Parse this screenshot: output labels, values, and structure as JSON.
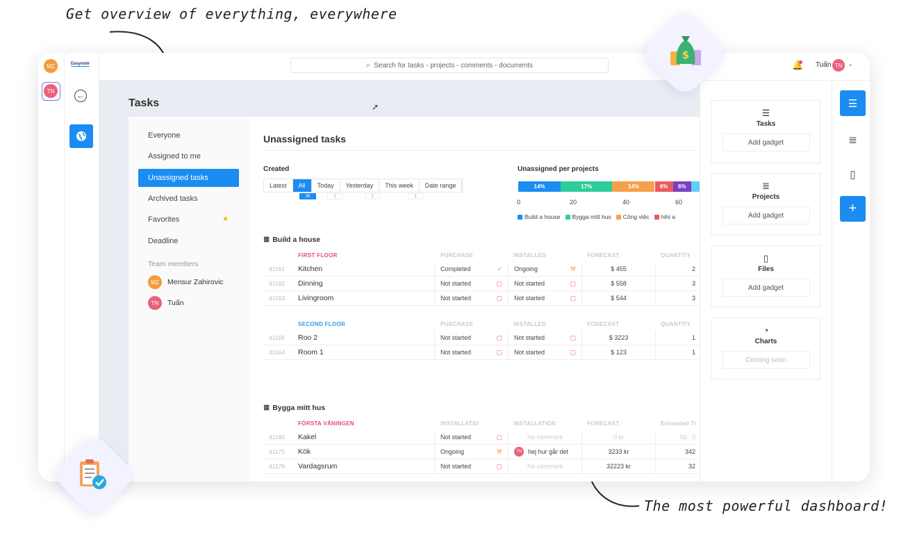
{
  "captions": {
    "top": "Get overview of everything, everywhere",
    "bottom": "The most powerful dashboard!"
  },
  "app": {
    "logo": "Easynote",
    "search_placeholder": "Search for tasks - projects - comments - documents",
    "user_name": "Tuấn",
    "user_initials": "TN",
    "rail_avatars": [
      {
        "initials": "MZ",
        "color": "#f39c3c"
      },
      {
        "initials": "TN",
        "color": "#e9627a"
      }
    ]
  },
  "page": {
    "title": "Tasks"
  },
  "leftnav": {
    "items": [
      "Everyone",
      "Assigned to me",
      "Unassigned tasks",
      "Archived tasks",
      "Favorites",
      "Deadline"
    ],
    "team_label": "Team members",
    "members": [
      {
        "initials": "MZ",
        "name": "Mensur Zahirovic",
        "color": "#f39c3c"
      },
      {
        "initials": "TN",
        "name": "Tuấn",
        "color": "#e9627a"
      }
    ]
  },
  "main": {
    "title": "Unassigned tasks",
    "created_label": "Created",
    "filters": [
      "Latest",
      "All",
      "Today",
      "Yesterday",
      "This week",
      "Date range"
    ],
    "all_count": "36",
    "sub_counts": [
      "1",
      "1",
      "1"
    ],
    "chart_label": "Unassigned per projects"
  },
  "chart_data": {
    "type": "bar",
    "orientation": "stacked-horizontal",
    "series": [
      {
        "name": "Build a house",
        "value": 14,
        "color": "#1b8cf1",
        "label": "14%"
      },
      {
        "name": "Bygga mitt hus",
        "value": 17,
        "color": "#2ecc9a",
        "label": "17%"
      },
      {
        "name": "Công việc",
        "value": 14,
        "color": "#f7a04b",
        "label": "14%"
      },
      {
        "name": "hihi a",
        "value": 6,
        "color": "#ea5a5a",
        "label": "6%"
      },
      {
        "name": "",
        "value": 6,
        "color": "#7b3fc2",
        "label": "6%"
      },
      {
        "name": "",
        "value": 18,
        "color": "#5fd0f5",
        "label": ""
      }
    ],
    "ticks": [
      "0",
      "20",
      "40",
      "60"
    ],
    "xlim": [
      0,
      60
    ]
  },
  "groups": [
    {
      "name": "Build a house",
      "sections": [
        {
          "name": "FIRST FLOOR",
          "color": "pink",
          "columns": [
            "PURCHASE",
            "INSTALLED",
            "FORECAST",
            "QUANTITY"
          ],
          "rows": [
            {
              "id": "41161",
              "name": "Kitchen",
              "c1": "Completed",
              "i1": "check",
              "c2": "Ongoing",
              "i2": "hammer",
              "forecast": "$ 455",
              "qty": "2"
            },
            {
              "id": "41162",
              "name": "Dinning",
              "c1": "Not started",
              "i1": "box",
              "c2": "Not started",
              "i2": "box",
              "forecast": "$ 558",
              "qty": "3"
            },
            {
              "id": "41163",
              "name": "Livingroom",
              "c1": "Not started",
              "i1": "box",
              "c2": "Not started",
              "i2": "box",
              "forecast": "$ 544",
              "qty": "3"
            }
          ]
        },
        {
          "name": "SECOND FLOOR",
          "color": "blue",
          "columns": [
            "PURCHASE",
            "INSTALLED",
            "FORECAST",
            "QUANTITY"
          ],
          "rows": [
            {
              "id": "41165",
              "name": "Roo 2",
              "c1": "Not started",
              "i1": "box",
              "c2": "Not started",
              "i2": "box",
              "forecast": "$ 3223",
              "qty": "1"
            },
            {
              "id": "41164",
              "name": "Room 1",
              "c1": "Not started",
              "i1": "box",
              "c2": "Not started",
              "i2": "box",
              "forecast": "$ 123",
              "qty": "1"
            }
          ]
        }
      ]
    },
    {
      "name": "Bygga mitt hus",
      "sections": [
        {
          "name": "FÖRSTA VÅNINGEN",
          "color": "pink",
          "columns": [
            "INSTALLATIO",
            "INSTALLATION",
            "FORECAST",
            "Estimated Ti"
          ],
          "rows": [
            {
              "id": "41180",
              "name": "Kakel",
              "c1": "Not started",
              "i1": "box",
              "c2": "No comment",
              "i2": "",
              "forecast": "0 kr",
              "qty": "0d : 0"
            },
            {
              "id": "41175",
              "name": "Kök",
              "c1": "Ongoing",
              "i1": "hammer",
              "c2": "hej hur går det",
              "i2": "",
              "c2avatar": "TN",
              "forecast": "3233 kr",
              "qty": "342"
            },
            {
              "id": "41176",
              "name": "Vardagsrum",
              "c1": "Not started",
              "i1": "box",
              "c2": "No comment",
              "i2": "",
              "forecast": "32223 kr",
              "qty": "32"
            }
          ]
        }
      ]
    }
  ],
  "gadgets": [
    {
      "title": "Tasks",
      "icon": "task-list-icon",
      "button": "Add gadget"
    },
    {
      "title": "Projects",
      "icon": "projects-icon",
      "button": "Add gadget"
    },
    {
      "title": "Files",
      "icon": "files-icon",
      "button": "Add gadget"
    },
    {
      "title": "Charts",
      "icon": "chart-icon",
      "button": "Coming soon"
    }
  ],
  "colors": {
    "accent": "#1b8cf1",
    "pink": "#e5497a",
    "blue": "#2e9be8"
  }
}
